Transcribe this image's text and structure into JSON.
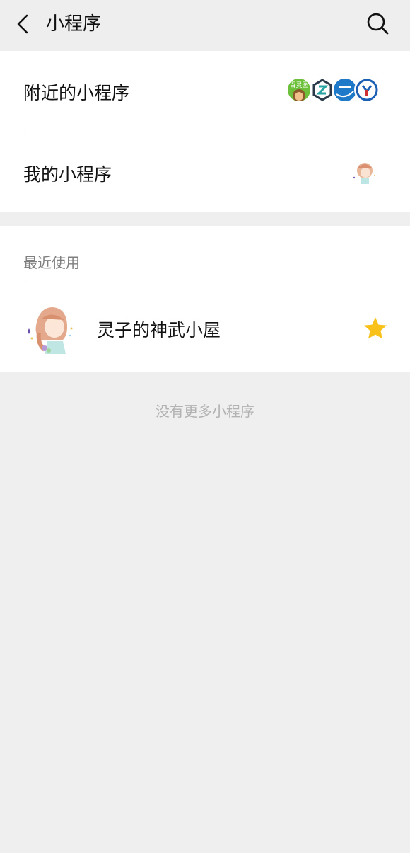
{
  "header": {
    "title": "小程序",
    "back_icon": "chevron-left-icon",
    "search_icon": "search-icon"
  },
  "menu": {
    "nearby_label": "附近的小程序",
    "nearby_icon_texts": [
      "百灵园"
    ],
    "mine_label": "我的小程序"
  },
  "recent": {
    "section_title": "最近使用",
    "items": [
      {
        "name": "灵子的神武小屋",
        "starred": true,
        "star_color": "#f8c21a"
      }
    ]
  },
  "footer": {
    "no_more_text": "没有更多小程序"
  },
  "colors": {
    "background": "#efefef",
    "card": "#ffffff",
    "secondary_text": "#7f7f7f",
    "muted_text": "#b2b2b2",
    "star": "#f8c21a"
  }
}
